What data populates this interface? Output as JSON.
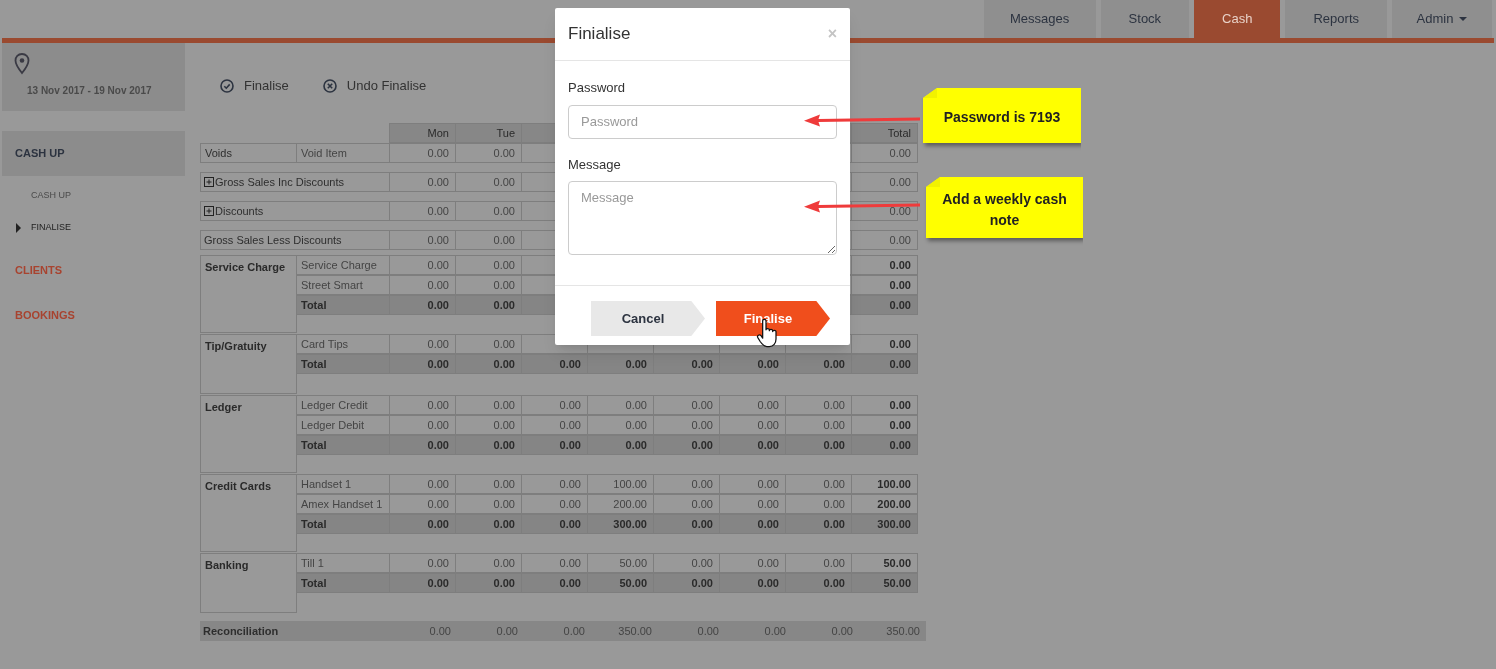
{
  "nav": [
    {
      "label": "Messages",
      "selected": false,
      "kind": "tab"
    },
    {
      "label": "Stock",
      "selected": false,
      "kind": "tab"
    },
    {
      "label": "Cash",
      "selected": true,
      "kind": "tab"
    },
    {
      "label": "Reports",
      "selected": false,
      "kind": "tab"
    },
    {
      "label": "Admin",
      "selected": false,
      "kind": "dropdown"
    }
  ],
  "sidebar": {
    "date_range": "13 Nov 2017 - 19 Nov 2017",
    "sections": [
      {
        "label": "CASH UP",
        "selected": true,
        "children": [
          {
            "label": "CASH UP",
            "selected": false
          },
          {
            "label": "FINALISE",
            "selected": true
          }
        ]
      },
      {
        "label": "CLIENTS",
        "selected": false
      },
      {
        "label": "BOOKINGS",
        "selected": false
      }
    ]
  },
  "actions": [
    {
      "label": "Finalise",
      "kind": "check"
    },
    {
      "label": "Undo Finalise",
      "kind": "cross"
    }
  ],
  "table": {
    "columns": [
      "Mon",
      "Tue"
    ],
    "total_column": "Total",
    "sections": [
      {
        "kind": "single",
        "label": "Voids",
        "sublabel": "Void Item",
        "values": [
          "0.00",
          "0.00"
        ],
        "total_value": "0.00"
      },
      {
        "kind": "expandable",
        "label": "Gross Sales Inc Discounts",
        "values": [
          "0.00",
          "0.00"
        ],
        "total_value": "0.00"
      },
      {
        "kind": "expandable",
        "label": "Discounts",
        "values": [
          "0.00",
          "0.00"
        ],
        "total_value": "0.00"
      },
      {
        "kind": "plain",
        "label": "Gross Sales Less Discounts",
        "values": [
          "0.00",
          "0.00"
        ],
        "total_value": "0.00"
      },
      {
        "kind": "group",
        "label": "Service Charge",
        "rows": [
          {
            "label": "Service Charge",
            "total": false,
            "values": [
              "0.00",
              "0.00"
            ],
            "total_value": "0.00"
          },
          {
            "label": "Street Smart",
            "total": false,
            "values": [
              "0.00",
              "0.00"
            ],
            "total_value": "0.00"
          },
          {
            "label": "Total",
            "total": true,
            "values": [
              "0.00",
              "0.00"
            ],
            "total_value": "0.00"
          }
        ]
      },
      {
        "kind": "group",
        "label": "Tip/Gratuity",
        "rows": [
          {
            "label": "Card Tips",
            "total": false,
            "values": [
              "0.00",
              "0.00"
            ],
            "total_value": "0.00"
          },
          {
            "label": "Total",
            "total": true,
            "values": [
              "0.00",
              "0.00",
              "0.00",
              "0.00",
              "0.00",
              "0.00",
              "0.00"
            ],
            "total_value": "0.00"
          }
        ]
      },
      {
        "kind": "group",
        "label": "Ledger",
        "rows": [
          {
            "label": "Ledger Credit",
            "total": false,
            "values": [
              "0.00",
              "0.00",
              "0.00",
              "0.00",
              "0.00",
              "0.00",
              "0.00"
            ],
            "total_value": "0.00"
          },
          {
            "label": "Ledger Debit",
            "total": false,
            "values": [
              "0.00",
              "0.00",
              "0.00",
              "0.00",
              "0.00",
              "0.00",
              "0.00"
            ],
            "total_value": "0.00"
          },
          {
            "label": "Total",
            "total": true,
            "values": [
              "0.00",
              "0.00",
              "0.00",
              "0.00",
              "0.00",
              "0.00",
              "0.00"
            ],
            "total_value": "0.00"
          }
        ]
      },
      {
        "kind": "group",
        "label": "Credit Cards",
        "rows": [
          {
            "label": "Handset 1",
            "total": false,
            "values": [
              "0.00",
              "0.00",
              "0.00",
              "100.00",
              "0.00",
              "0.00",
              "0.00"
            ],
            "total_value": "100.00"
          },
          {
            "label": "Amex Handset 1",
            "total": false,
            "values": [
              "0.00",
              "0.00",
              "0.00",
              "200.00",
              "0.00",
              "0.00",
              "0.00"
            ],
            "total_value": "200.00"
          },
          {
            "label": "Total",
            "total": true,
            "values": [
              "0.00",
              "0.00",
              "0.00",
              "300.00",
              "0.00",
              "0.00",
              "0.00"
            ],
            "total_value": "300.00"
          }
        ]
      },
      {
        "kind": "group",
        "label": "Banking",
        "rows": [
          {
            "label": "Till 1",
            "total": false,
            "values": [
              "0.00",
              "0.00",
              "0.00",
              "50.00",
              "0.00",
              "0.00",
              "0.00"
            ],
            "total_value": "50.00"
          },
          {
            "label": "Total",
            "total": true,
            "values": [
              "0.00",
              "0.00",
              "0.00",
              "50.00",
              "0.00",
              "0.00",
              "0.00"
            ],
            "total_value": "50.00"
          }
        ]
      },
      {
        "kind": "summary",
        "label": "Reconciliation",
        "values": [
          "0.00",
          "0.00",
          "0.00",
          "350.00",
          "0.00",
          "0.00",
          "0.00"
        ],
        "total_value": "350.00"
      }
    ]
  },
  "modal": {
    "title": "Finialise",
    "close": "×",
    "fields": [
      {
        "label": "Password",
        "placeholder": "Password",
        "kind": "input"
      },
      {
        "label": "Message",
        "placeholder": "Message",
        "kind": "textarea"
      }
    ],
    "buttons": [
      {
        "label": "Cancel",
        "kind": "secondary"
      },
      {
        "label": "Finalise",
        "kind": "primary"
      }
    ]
  },
  "callouts": [
    {
      "text": "Password is 7193"
    },
    {
      "text": "Add a weekly cash note"
    }
  ]
}
